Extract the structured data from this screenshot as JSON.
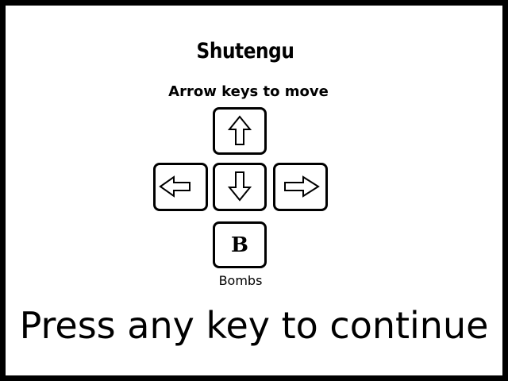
{
  "game": {
    "title": "Shutengu",
    "instructions": "Arrow keys to move",
    "bomb_key_letter": "B",
    "bomb_key_label": "Bombs",
    "prompt": "Press any key to continue"
  },
  "colors": {
    "frame": "#000000",
    "background": "#ffffff",
    "ink": "#000000"
  },
  "icons": {
    "up": "arrow-up-outline",
    "down": "arrow-down-outline",
    "left": "arrow-left-outline",
    "right": "arrow-right-outline"
  }
}
